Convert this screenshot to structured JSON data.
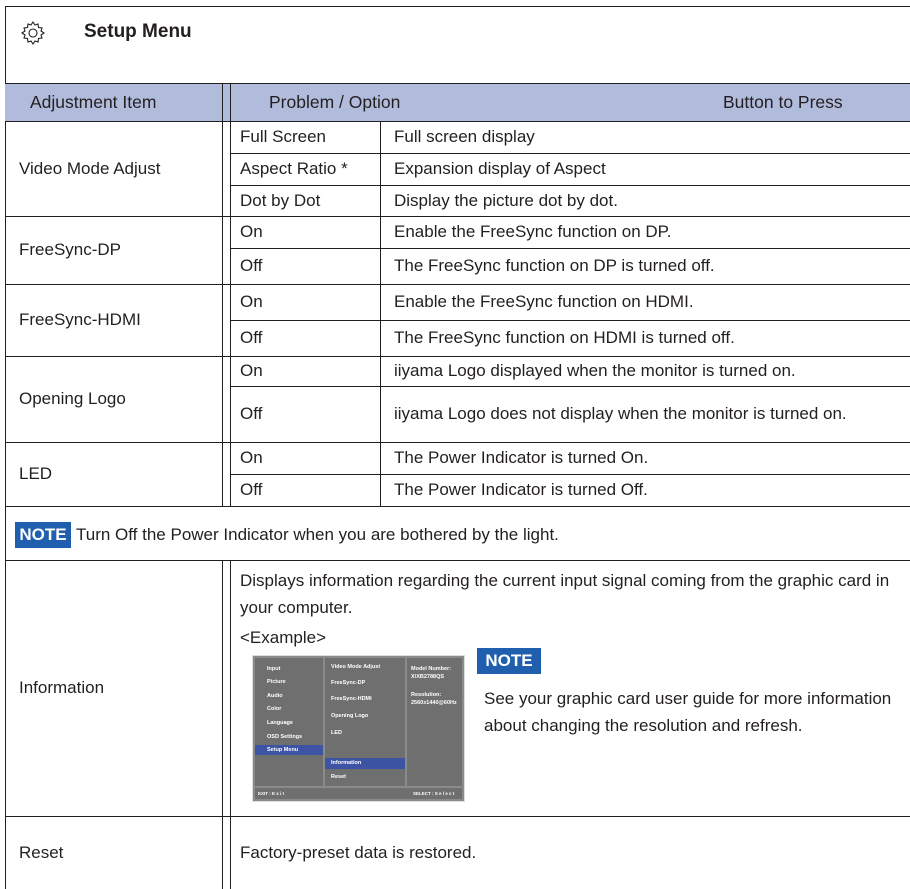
{
  "page": {
    "title": "Setup Menu",
    "header": {
      "col_item": "Adjustment Item",
      "col_problem": "Problem / Option",
      "col_button": "Button to Press"
    }
  },
  "rows": {
    "video_mode": {
      "label": "Video Mode Adjust",
      "options": [
        {
          "option": "Full Screen",
          "desc": "Full screen display"
        },
        {
          "option": "Aspect Ratio *",
          "desc": "Expansion display of Aspect"
        },
        {
          "option": "Dot by Dot",
          "desc": "Display the picture dot by dot."
        }
      ]
    },
    "freesync_dp": {
      "label": "FreeSync-DP",
      "options": [
        {
          "option": "On",
          "desc": "Enable the FreeSync function on DP."
        },
        {
          "option": "Off",
          "desc": "The FreeSync function on DP is turned off."
        }
      ]
    },
    "freesync_hdmi": {
      "label": "FreeSync-HDMI",
      "options": [
        {
          "option": "On",
          "desc": "Enable the FreeSync function on HDMI."
        },
        {
          "option": "Off",
          "desc": "The FreeSync function on HDMI is turned off."
        }
      ]
    },
    "opening_logo": {
      "label": "Opening Logo",
      "options": [
        {
          "option": "On",
          "desc": "iiyama Logo displayed when the monitor is turned on."
        },
        {
          "option": "Off",
          "desc": "iiyama Logo does not display when the monitor is turned on."
        }
      ]
    },
    "led": {
      "label": "LED",
      "options": [
        {
          "option": "On",
          "desc": "The Power Indicator is turned On."
        },
        {
          "option": "Off",
          "desc": "The Power Indicator is turned Off."
        }
      ]
    }
  },
  "note1": {
    "badge": "NOTE",
    "text": "Turn Off the Power Indicator when you are bothered by the light."
  },
  "information": {
    "label": "Information",
    "desc": "Displays information regarding the current input signal coming from the graphic card in your computer.",
    "example": "<Example>",
    "note_badge": "NOTE",
    "note_text": "See your graphic card user guide for more information about changing the resolution and refresh."
  },
  "osd": {
    "left_items": [
      "Input",
      "Picture",
      "Audio",
      "Color",
      "Language",
      "OSD Settings",
      "Setup Menu"
    ],
    "middle_items": [
      "Video Mode Adjust",
      "FreeSync-DP",
      "FreeSync-HDMI",
      "Opening Logo",
      "LED",
      "Information",
      "Reset"
    ],
    "model_label": "Model Number:",
    "model_value": "X/XB2788QS",
    "res_label": "Resolution:",
    "res_value": "2560x1440@60Hz",
    "exit": "EXIT : E x i t",
    "select": "SELECT : S e l e c t",
    "selected_color": "#3d53a3"
  },
  "reset": {
    "label": "Reset",
    "desc": "Factory-preset data is restored."
  },
  "colors": {
    "header_bg": "#b1bcdd",
    "note_badge_bg": "#1f5fae"
  }
}
